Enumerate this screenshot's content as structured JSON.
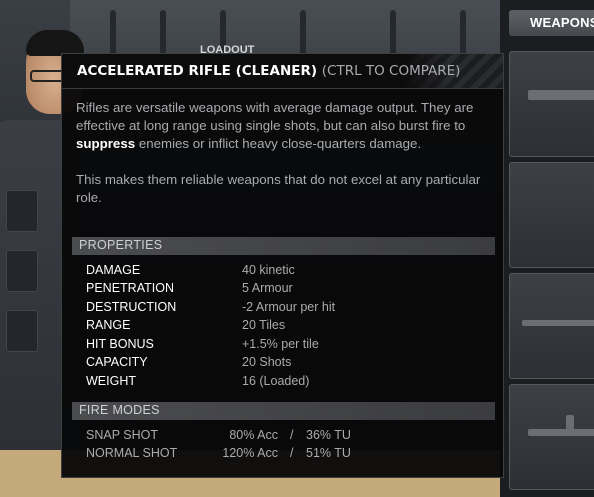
{
  "background": {
    "loadout_label": "LOADOUT"
  },
  "right_panel": {
    "tab_label": "WEAPONS",
    "slots": [
      "weapon-slot-1",
      "weapon-slot-2",
      "weapon-slot-3",
      "weapon-slot-4"
    ]
  },
  "tooltip": {
    "title": "ACCELERATED RIFLE (CLEANER)",
    "compare_hint": "(CTRL TO COMPARE)",
    "description": {
      "para1_before": "Rifles are versatile weapons with average damage output. They are effective at long range using single shots, but can also burst fire to ",
      "para1_bold": "suppress",
      "para1_after": " enemies or inflict heavy close-quarters damage.",
      "para2": "This makes them reliable weapons that do not excel at any particular role."
    },
    "properties_heading": "PROPERTIES",
    "properties": [
      {
        "label": "DAMAGE",
        "value": "40 kinetic"
      },
      {
        "label": "PENETRATION",
        "value": "5 Armour"
      },
      {
        "label": "DESTRUCTION",
        "value": "-2 Armour per hit"
      },
      {
        "label": "RANGE",
        "value": "20 Tiles"
      },
      {
        "label": "HIT BONUS",
        "value": "+1.5% per tile"
      },
      {
        "label": "CAPACITY",
        "value": "20 Shots"
      },
      {
        "label": "WEIGHT",
        "value": "16 (Loaded)"
      }
    ],
    "fire_modes_heading": "FIRE MODES",
    "fire_modes": [
      {
        "name": "SNAP SHOT",
        "accuracy": "80% Acc",
        "separator": "/",
        "tu": "36% TU"
      },
      {
        "name": "NORMAL SHOT",
        "accuracy": "120% Acc",
        "separator": "/",
        "tu": "51% TU"
      }
    ]
  }
}
